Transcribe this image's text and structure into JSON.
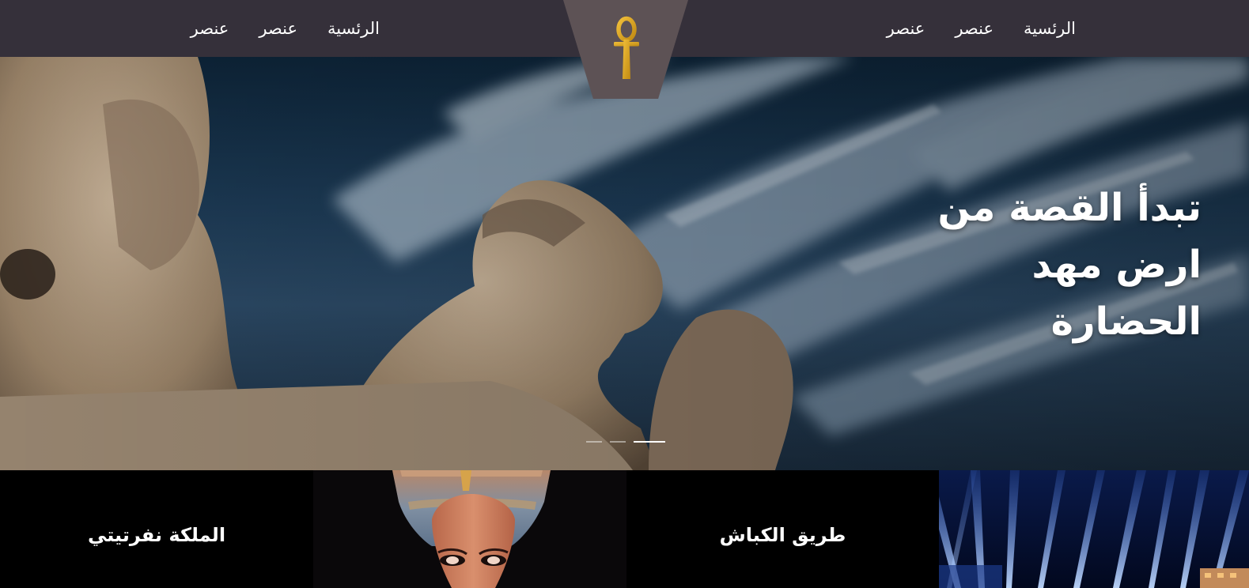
{
  "header": {
    "nav_right": [
      "الرئسية",
      "عنصر",
      "عنصر"
    ],
    "nav_left": [
      "الرئسية",
      "عنصر",
      "عنصر"
    ],
    "logo_icon": "ankh-icon",
    "colors": {
      "bar": "#35303a",
      "logo_bg": "#5d5255",
      "ankh": "#d9a21f"
    }
  },
  "hero": {
    "title_lines": [
      "تبدأ القصة من",
      "ارض مهد",
      "الحضارة"
    ],
    "slides_count": 3,
    "active_slide": 3
  },
  "cards": [
    {
      "title": "الملكة نفرتيتي"
    },
    {
      "image": "nefertiti-bust"
    },
    {
      "title": "طريق الكباش"
    },
    {
      "image": "light-show"
    }
  ]
}
